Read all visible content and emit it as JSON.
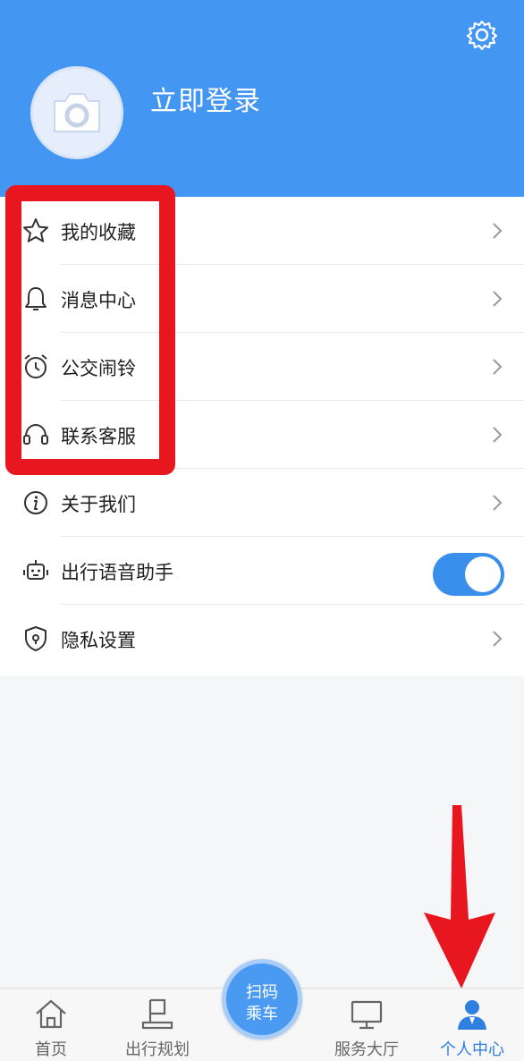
{
  "header": {
    "login_label": "立即登录",
    "avatar_icon": "camera-icon",
    "settings_icon": "gear-icon",
    "bg_color": "#4496f3"
  },
  "menu": {
    "items": [
      {
        "label": "我的收藏",
        "icon": "star-icon"
      },
      {
        "label": "消息中心",
        "icon": "bell-icon"
      },
      {
        "label": "公交闹铃",
        "icon": "alarm-clock-icon"
      },
      {
        "label": "联系客服",
        "icon": "headset-icon"
      },
      {
        "label": "关于我们",
        "icon": "info-icon"
      },
      {
        "label": "出行语音助手",
        "icon": "robot-icon",
        "toggle_on": true
      },
      {
        "label": "隐私设置",
        "icon": "shield-icon"
      }
    ]
  },
  "tabbar": {
    "tabs": [
      {
        "label": "首页",
        "icon": "home-icon"
      },
      {
        "label": "出行规划",
        "icon": "flag-icon"
      },
      {
        "label": "服务大厅",
        "icon": "monitor-icon"
      },
      {
        "label": "个人中心",
        "icon": "person-icon",
        "active": true
      }
    ],
    "scan_button": {
      "line1": "扫码",
      "line2": "乘车"
    },
    "active_color": "#2f7fe0"
  },
  "annotations": {
    "highlight_color": "#e8161e"
  }
}
